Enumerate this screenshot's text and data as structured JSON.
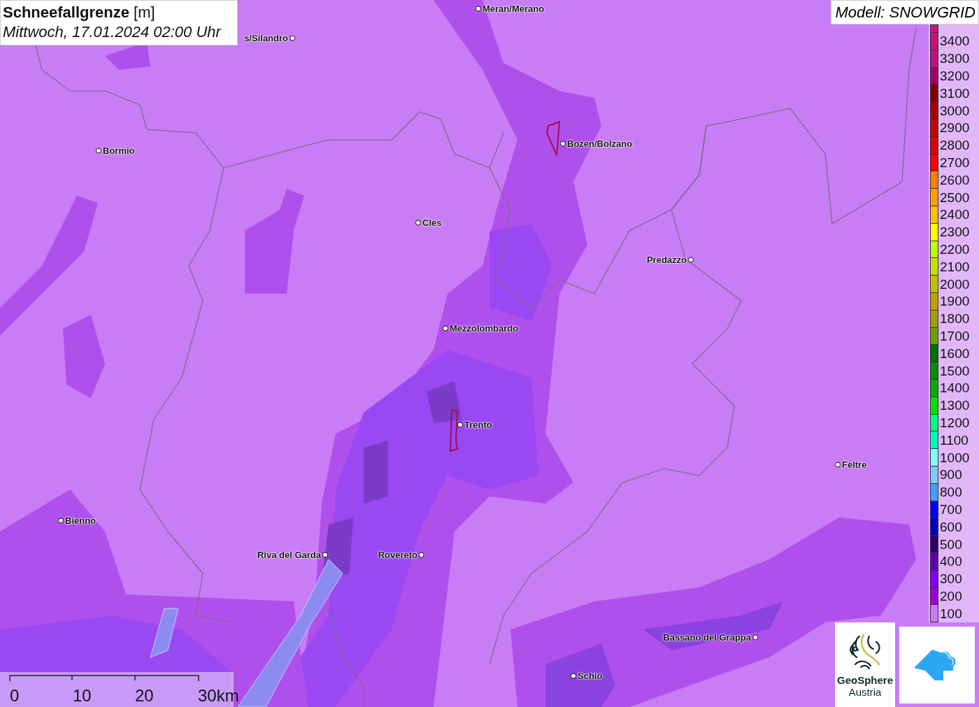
{
  "title": {
    "name": "Schneefallgrenze",
    "unit": "[m]",
    "subtitle": "Mittwoch, 17.01.2024 02:00 Uhr"
  },
  "model": "Modell: SNOWGRID",
  "legend": [
    {
      "label": "3400",
      "color": "#d0107a"
    },
    {
      "label": "3300",
      "color": "#c01080"
    },
    {
      "label": "3200",
      "color": "#a00070"
    },
    {
      "label": "3100",
      "color": "#800000"
    },
    {
      "label": "3000",
      "color": "#a80000"
    },
    {
      "label": "2900",
      "color": "#c80000"
    },
    {
      "label": "2800",
      "color": "#e00000"
    },
    {
      "label": "2700",
      "color": "#ff0000"
    },
    {
      "label": "2600",
      "color": "#ff8000"
    },
    {
      "label": "2500",
      "color": "#ffa000"
    },
    {
      "label": "2400",
      "color": "#ffc000"
    },
    {
      "label": "2300",
      "color": "#ffff00"
    },
    {
      "label": "2200",
      "color": "#c0ff00"
    },
    {
      "label": "2100",
      "color": "#c8e000"
    },
    {
      "label": "2000",
      "color": "#c0c000"
    },
    {
      "label": "1900",
      "color": "#c0a000"
    },
    {
      "label": "1800",
      "color": "#a0a000"
    },
    {
      "label": "1700",
      "color": "#70a000"
    },
    {
      "label": "1600",
      "color": "#007000"
    },
    {
      "label": "1500",
      "color": "#009000"
    },
    {
      "label": "1400",
      "color": "#00b000"
    },
    {
      "label": "1300",
      "color": "#00e000"
    },
    {
      "label": "1200",
      "color": "#00ff80"
    },
    {
      "label": "1100",
      "color": "#00ffc0"
    },
    {
      "label": "1000",
      "color": "#80ffff"
    },
    {
      "label": "900",
      "color": "#80c8ff"
    },
    {
      "label": "800",
      "color": "#40a0ff"
    },
    {
      "label": "700",
      "color": "#0000ff"
    },
    {
      "label": "600",
      "color": "#0000c0"
    },
    {
      "label": "500",
      "color": "#300070"
    },
    {
      "label": "400",
      "color": "#6000b0"
    },
    {
      "label": "300",
      "color": "#8000ff"
    },
    {
      "label": "200",
      "color": "#a000e0"
    },
    {
      "label": "100",
      "color": "#c878f8"
    }
  ],
  "cities": [
    {
      "name": "Meran/Merano",
      "kind": "right"
    },
    {
      "name": "s/Silandro",
      "kind": "left"
    },
    {
      "name": "Bormio",
      "kind": "right"
    },
    {
      "name": "Bozen/Bolzano",
      "kind": "right"
    },
    {
      "name": "Cles",
      "kind": "right"
    },
    {
      "name": "Predazzo",
      "kind": "left"
    },
    {
      "name": "Mezzolombardo",
      "kind": "right"
    },
    {
      "name": "Trento",
      "kind": "right"
    },
    {
      "name": "Feltre",
      "kind": "right"
    },
    {
      "name": "Bienno",
      "kind": "right"
    },
    {
      "name": "Riva del Garda",
      "kind": "left"
    },
    {
      "name": "Rovereto",
      "kind": "left"
    },
    {
      "name": "Bassano del Grappa",
      "kind": "left"
    },
    {
      "name": "Schio",
      "kind": "right"
    }
  ],
  "scale_bar": [
    "0",
    "10",
    "20",
    "30km"
  ],
  "logo": {
    "name": "GeoSphere",
    "sub": "Austria"
  }
}
